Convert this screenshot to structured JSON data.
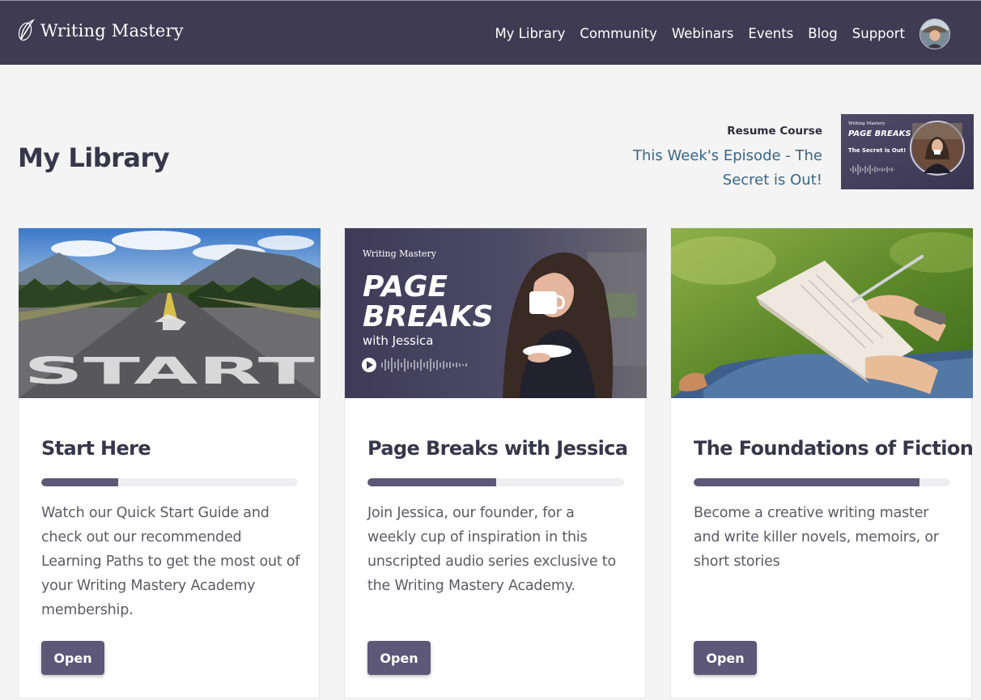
{
  "header": {
    "brand": "Writing Mastery",
    "nav": [
      "My Library",
      "Community",
      "Webinars",
      "Events",
      "Blog",
      "Support"
    ]
  },
  "page": {
    "title": "My Library"
  },
  "resume": {
    "label": "Resume Course",
    "link_line1": "This Week's Episode - The",
    "link_line2": "Secret is Out!",
    "thumb": {
      "brand": "Writing Mastery",
      "title": "PAGE BREAKS",
      "subtitle": "The Secret is Out!"
    }
  },
  "cards": [
    {
      "title": "Start Here",
      "progress": 0.3,
      "description": "Watch our Quick Start Guide and check out our recommended Learning Paths to get the most out of your Writing Mastery Academy membership.",
      "button": "Open",
      "image": {
        "road_text": "START"
      }
    },
    {
      "title": "Page Breaks with Jessica",
      "progress": 0.5,
      "description": "Join Jessica, our founder, for a weekly cup of inspiration in this unscripted audio series exclusive to the Writing Mastery Academy.",
      "button": "Open",
      "image": {
        "brand": "Writing Mastery",
        "line1": "PAGE",
        "line2": "BREAKS",
        "line3": "with Jessica"
      }
    },
    {
      "title": "The Foundations of Fiction",
      "progress": 0.88,
      "description": "Become a creative writing master and write killer novels, memoirs, or short stories",
      "button": "Open",
      "image": {}
    }
  ],
  "colors": {
    "header_bg": "#3f3b52",
    "accent": "#5d5878",
    "link": "#3a6688",
    "page_bg": "#f4f4f4"
  },
  "icons": [
    "quill-icon",
    "user-avatar",
    "play-icon",
    "waveform-icon"
  ]
}
